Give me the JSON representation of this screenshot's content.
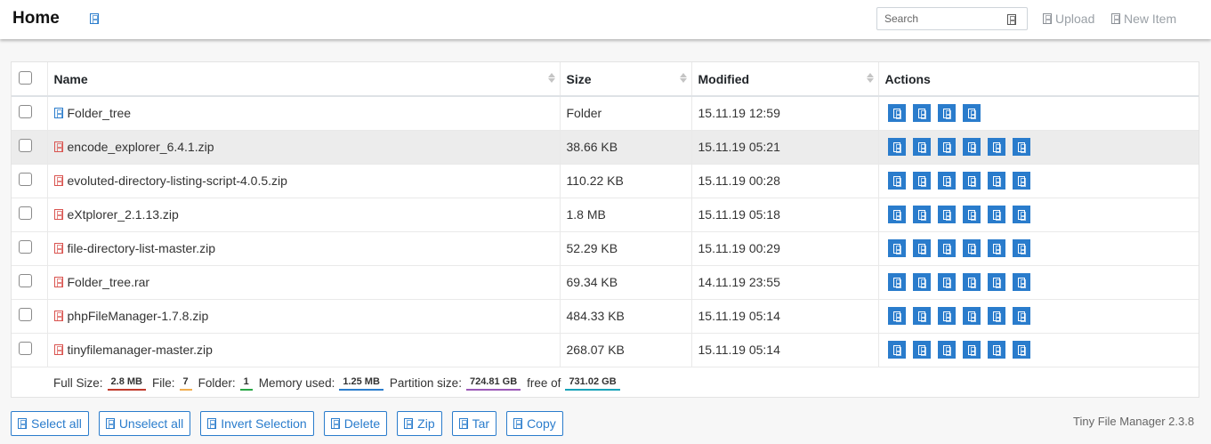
{
  "header": {
    "title": "Home",
    "search_placeholder": "Search",
    "upload_label": "Upload",
    "new_item_label": "New Item"
  },
  "table": {
    "columns": [
      "Name",
      "Size",
      "Modified",
      "Actions"
    ],
    "rows": [
      {
        "name": "Folder_tree",
        "size": "Folder",
        "modified": "15.11.19 12:59",
        "type": "folder",
        "actions": 4
      },
      {
        "name": "encode_explorer_6.4.1.zip",
        "size": "38.66 KB",
        "modified": "15.11.19 05:21",
        "type": "file",
        "actions": 6
      },
      {
        "name": "evoluted-directory-listing-script-4.0.5.zip",
        "size": "110.22 KB",
        "modified": "15.11.19 00:28",
        "type": "file",
        "actions": 6
      },
      {
        "name": "eXtplorer_2.1.13.zip",
        "size": "1.8 MB",
        "modified": "15.11.19 05:18",
        "type": "file",
        "actions": 6
      },
      {
        "name": "file-directory-list-master.zip",
        "size": "52.29 KB",
        "modified": "15.11.19 00:29",
        "type": "file",
        "actions": 6
      },
      {
        "name": "Folder_tree.rar",
        "size": "69.34 KB",
        "modified": "14.11.19 23:55",
        "type": "file",
        "actions": 6
      },
      {
        "name": "phpFileManager-1.7.8.zip",
        "size": "484.33 KB",
        "modified": "15.11.19 05:14",
        "type": "file",
        "actions": 6
      },
      {
        "name": "tinyfilemanager-master.zip",
        "size": "268.07 KB",
        "modified": "15.11.19 05:14",
        "type": "file",
        "actions": 6
      }
    ]
  },
  "footer_stats": {
    "full_size_label": "Full Size:",
    "full_size_value": "2.8 MB",
    "file_label": "File:",
    "file_value": "7",
    "folder_label": "Folder:",
    "folder_value": "1",
    "memory_label": "Memory used:",
    "memory_value": "1.25 MB",
    "partition_label": "Partition size:",
    "partition_value": "724.81 GB",
    "free_label": "free of",
    "free_value": "731.02 GB"
  },
  "bulk_actions": [
    "Select all",
    "Unselect all",
    "Invert Selection",
    "Delete",
    "Zip",
    "Tar",
    "Copy"
  ],
  "version": "Tiny File Manager 2.3.8",
  "colors": {
    "accent": "#2a7ccc",
    "folder_icon": "#2a7ccc",
    "file_icon": "#d9534f",
    "pill_full_size": "#c0392b",
    "pill_file": "#f0ad4e",
    "pill_folder": "#28a745",
    "pill_memory": "#2a7ccc",
    "pill_partition": "#9b59b6",
    "pill_free": "#17a2b8"
  }
}
